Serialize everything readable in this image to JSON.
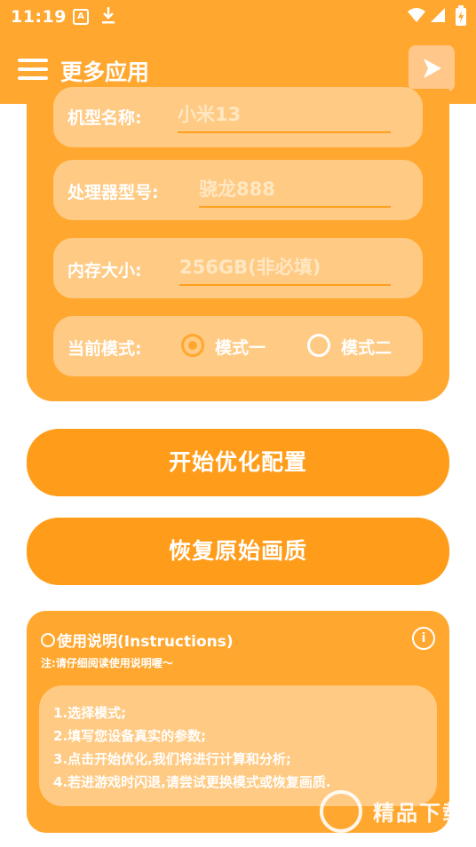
{
  "status_bar": {
    "time": "11:19",
    "a_badge": "A"
  },
  "app_bar": {
    "title": "更多应用"
  },
  "config": {
    "model": {
      "label": "机型名称:",
      "placeholder": "小米13"
    },
    "processor": {
      "label": "处理器型号:",
      "placeholder": "骁龙888"
    },
    "memory": {
      "label": "内存大小:",
      "placeholder": "256GB(非必填)"
    },
    "mode": {
      "label": "当前模式:",
      "options": [
        "模式一",
        "模式二"
      ],
      "selected": "模式一"
    }
  },
  "buttons": {
    "start": "开始优化配置",
    "restore": "恢复原始画质"
  },
  "instructions": {
    "title": "使用说明(Instructions)",
    "note": "注:请仔细阅读使用说明喔～",
    "steps": [
      "1.选择模式;",
      "2.填写您设备真实的参数;",
      "3.点击开始优化,我们将进行计算和分析;",
      "4.若进游戏时闪退,请尝试更换模式或恢复画质."
    ]
  },
  "watermark": {
    "text": "精品下载"
  },
  "colors": {
    "primary": "#ffa72e",
    "button": "#ff9c1a",
    "field_bg": "#ffca83",
    "text": "#ffffff"
  }
}
